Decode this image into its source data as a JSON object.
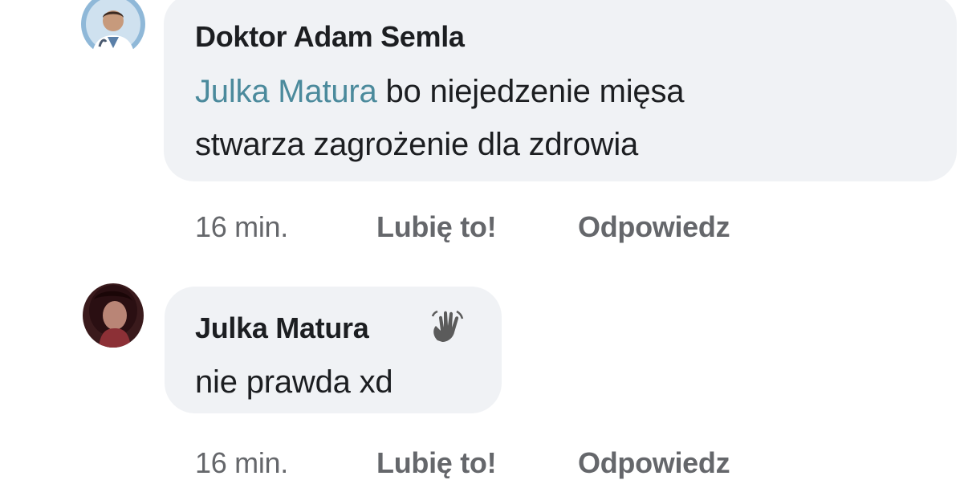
{
  "comments": [
    {
      "author": "Doktor Adam Semla",
      "mention": "Julka Matura",
      "text_line1": " bo niejedzenie mięsa",
      "text_line2": "stwarza zagrożenie dla zdrowia",
      "time": "16 min.",
      "like_label": "Lubię to!",
      "reply_label": "Odpowiedz"
    },
    {
      "author": "Julka Matura",
      "badge_icon": "waving-hand-icon",
      "text_line1": "nie prawda xd",
      "time": "16 min.",
      "like_label": "Lubię to!",
      "reply_label": "Odpowiedz"
    }
  ],
  "colors": {
    "bubble": "#f0f2f5",
    "mention": "#4b8a9c",
    "meta": "#65676b",
    "text": "#1c1e21"
  }
}
